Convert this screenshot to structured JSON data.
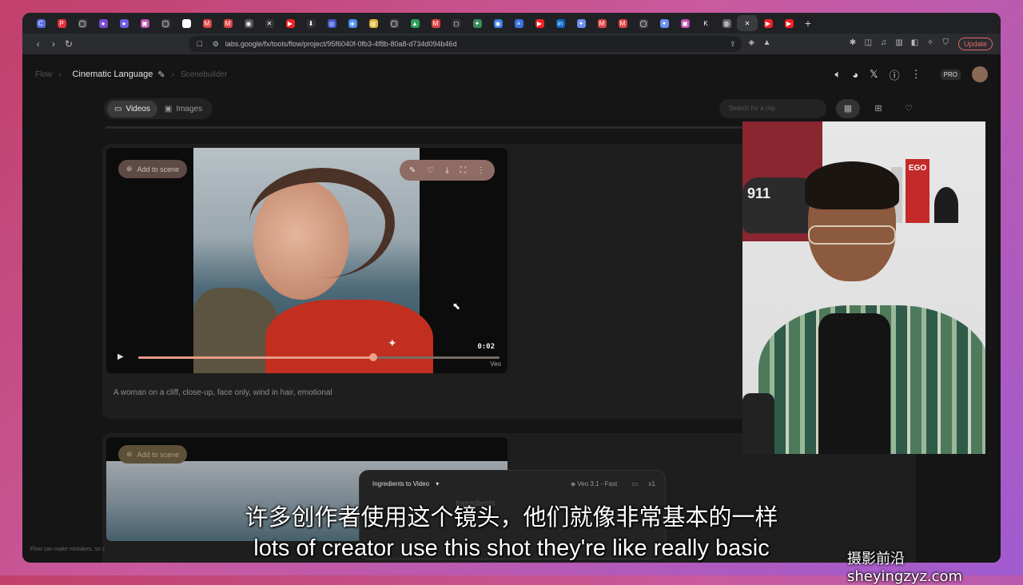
{
  "browser": {
    "address": "labs.google/fx/tools/flow/project/95f6040f-0fb3-4f8b-80a8-d734d094b46d",
    "update_label": "Update",
    "tabs": [
      {
        "icon": "c-icon",
        "color": "#5b6bdf",
        "glyph": "C"
      },
      {
        "icon": "pinterest-icon",
        "color": "#e0333f",
        "glyph": "P"
      },
      {
        "icon": "globe-icon",
        "color": "#444",
        "glyph": "◯"
      },
      {
        "icon": "app-icon",
        "color": "#7a4bd0",
        "glyph": "●"
      },
      {
        "icon": "app-icon",
        "color": "#6e5ce0",
        "glyph": "●"
      },
      {
        "icon": "photo-icon",
        "color": "#c04fb0",
        "glyph": "▣"
      },
      {
        "icon": "globe-icon",
        "color": "#444",
        "glyph": "◯"
      },
      {
        "icon": "google-icon",
        "color": "#ffffff",
        "glyph": "G"
      },
      {
        "icon": "gmail-icon",
        "color": "#d44",
        "glyph": "M"
      },
      {
        "icon": "gmail-icon",
        "color": "#d44",
        "glyph": "M"
      },
      {
        "icon": "app-icon",
        "color": "#555",
        "glyph": "◉"
      },
      {
        "icon": "app-icon",
        "color": "#333",
        "glyph": "✕"
      },
      {
        "icon": "youtube-icon",
        "color": "#e22",
        "glyph": "▶"
      },
      {
        "icon": "download-icon",
        "color": "#333",
        "glyph": "⬇"
      },
      {
        "icon": "globe-icon",
        "color": "#4055c8",
        "glyph": "◎"
      },
      {
        "icon": "app-icon",
        "color": "#4b8ef0",
        "glyph": "◈"
      },
      {
        "icon": "app-icon",
        "color": "#e2b33a",
        "glyph": "◍"
      },
      {
        "icon": "globe-icon",
        "color": "#444",
        "glyph": "◯"
      },
      {
        "icon": "drive-icon",
        "color": "#2d9e5a",
        "glyph": "▲"
      },
      {
        "icon": "gmail-icon",
        "color": "#d44",
        "glyph": "M"
      },
      {
        "icon": "app-icon",
        "color": "#333",
        "glyph": "◻"
      },
      {
        "icon": "app-icon",
        "color": "#3a8a5a",
        "glyph": "✦"
      },
      {
        "icon": "chrome-icon",
        "color": "#3b7de0",
        "glyph": "◉"
      },
      {
        "icon": "docs-icon",
        "color": "#3b6fe0",
        "glyph": "≡"
      },
      {
        "icon": "youtube-icon",
        "color": "#e22",
        "glyph": "▶"
      },
      {
        "icon": "linkedin-icon",
        "color": "#0a66c2",
        "glyph": "in"
      },
      {
        "icon": "gemini-icon",
        "color": "#6b8ff0",
        "glyph": "✦"
      },
      {
        "icon": "gmail-icon",
        "color": "#d44",
        "glyph": "M"
      },
      {
        "icon": "gmail-icon",
        "color": "#d44",
        "glyph": "M"
      },
      {
        "icon": "globe-icon",
        "color": "#444",
        "glyph": "◯"
      },
      {
        "icon": "gemini-icon",
        "color": "#6b8ff0",
        "glyph": "✦"
      },
      {
        "icon": "photo-icon",
        "color": "#c04fb0",
        "glyph": "▣"
      },
      {
        "icon": "k-icon",
        "color": "#222",
        "glyph": "K"
      },
      {
        "icon": "app-icon",
        "color": "#666",
        "glyph": "◍"
      },
      {
        "icon": "close-icon",
        "color": "#3a3b3e",
        "glyph": "✕",
        "active": true
      },
      {
        "icon": "youtube-icon",
        "color": "#e22",
        "glyph": "▶"
      },
      {
        "icon": "youtube-icon",
        "color": "#e22",
        "glyph": "▶"
      }
    ]
  },
  "app": {
    "breadcrumb_root": "Flow",
    "project_title": "Cinematic Language",
    "breadcrumb_child": "Scenebuilder",
    "pro_badge": "PRO",
    "media_tabs": [
      {
        "label": "Videos",
        "active": true
      },
      {
        "label": "Images",
        "active": false
      }
    ],
    "search_placeholder": "Search for a clip",
    "footnote": "Flow can make mistakes, so c"
  },
  "clip1": {
    "add_to_scene": "Add to scene",
    "time": "0:02",
    "watermark": "Veo",
    "progress": 0.65,
    "prompt": "A woman on a cliff, close-up, face only, wind in hair, emotional"
  },
  "clip2": {
    "add_to_scene": "Add to scene"
  },
  "composer": {
    "mode": "Ingredients to Video",
    "model": "Veo 3.1 - Fast",
    "count": "x1",
    "placeholder": "Ingredients"
  },
  "subtitles": {
    "zh": "许多创作者使用这个镜头，他们就像非常基本的一样",
    "en": "lots of creator use this shot they're like really basic"
  },
  "branding": {
    "watermark": "摄影前沿 sheyingzyz.com"
  },
  "webcam": {
    "poster_text": "911",
    "book_text": "EGO"
  }
}
